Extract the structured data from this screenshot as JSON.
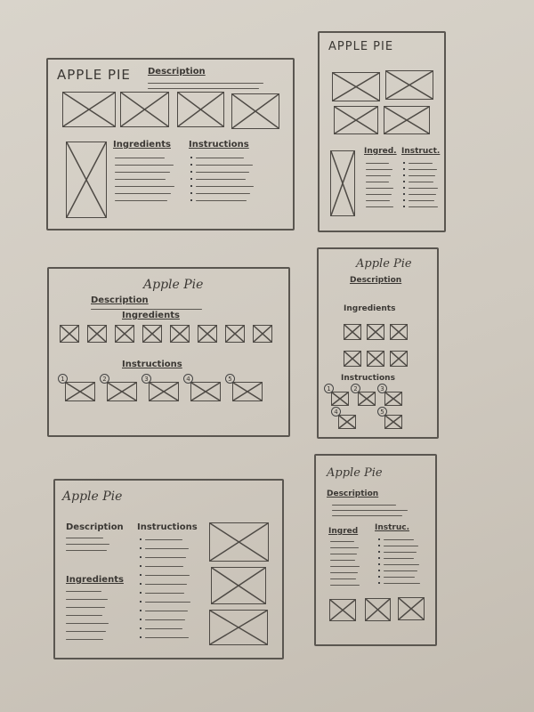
{
  "sketches": [
    {
      "title": "APPLE PIE",
      "description": "Description",
      "ingredients": "Ingredients",
      "instructions": "Instructions"
    },
    {
      "title": "APPLE PIE",
      "ingredients": "Ingred.",
      "instructions": "Instruct."
    },
    {
      "title": "Apple Pie",
      "description": "Description",
      "ingredients": "Ingredients",
      "instructions": "Instructions",
      "steps": [
        "1",
        "2",
        "3",
        "4",
        "5"
      ]
    },
    {
      "title": "Apple Pie",
      "description": "Description",
      "ingredients": "Ingredients",
      "instructions": "Instructions",
      "steps": [
        "1",
        "2",
        "3",
        "4",
        "5"
      ]
    },
    {
      "title": "Apple Pie",
      "description": "Description",
      "ingredients": "Ingredients",
      "instructions": "Instructions"
    },
    {
      "title": "Apple Pie",
      "description": "Description",
      "ingredients": "Ingred",
      "instructions": "Instruc."
    }
  ],
  "colors": {
    "paper": "#d4cec5",
    "pencil": "#4e4a45"
  }
}
